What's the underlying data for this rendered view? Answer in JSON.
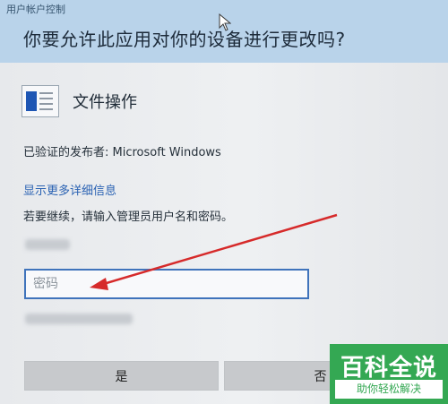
{
  "dialog": {
    "header_small": "用户帐户控制",
    "title": "你要允许此应用对你的设备进行更改吗?",
    "app_name": "文件操作",
    "publisher": "已验证的发布者: Microsoft Windows",
    "details_link": "显示更多详细信息",
    "instruction": "若要继续，请输入管理员用户名和密码。",
    "password_placeholder": "密码",
    "yes_label": "是",
    "no_label": "否",
    "icon": "app-window-icon"
  },
  "annotation": {
    "arrow_color": "#d62a2a"
  },
  "watermark": {
    "title": "百科全说",
    "subtitle": "助你轻松解决",
    "color": "#34a853"
  }
}
